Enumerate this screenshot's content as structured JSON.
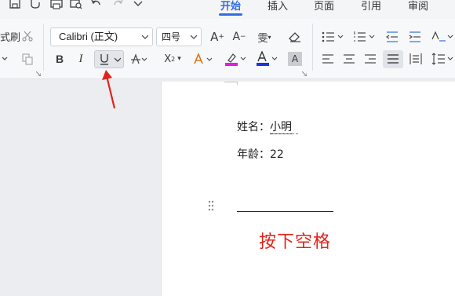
{
  "tabs": [
    {
      "label": "开始",
      "active": true
    },
    {
      "label": "插入",
      "active": false
    },
    {
      "label": "页面",
      "active": false
    },
    {
      "label": "引用",
      "active": false
    },
    {
      "label": "审阅",
      "active": false
    }
  ],
  "quick_access": [
    "save-icon",
    "format-painter-small-icon",
    "print-icon",
    "print-preview-icon",
    "undo-icon",
    "redo-icon",
    "more-chevron-icon"
  ],
  "clipboard": {
    "format_painter_label": "式刷"
  },
  "font": {
    "name": "Calibri (正文)",
    "size": "四号"
  },
  "format_buttons": [
    "bold-icon",
    "italic-icon",
    "underline-icon",
    "strikethrough-icon",
    "superscript-icon",
    "text-effect-icon",
    "highlight-icon",
    "font-color-icon",
    "char-shading-icon"
  ],
  "colors": {
    "accent": "#2f6fe4",
    "highlight": "#e01ee0",
    "font_color": "#1a35e0",
    "annotation": "#e2231a"
  },
  "document": {
    "name_label": "姓名：",
    "name_value": "小明",
    "age_label": "年龄：",
    "age_value": "22"
  },
  "annotation": "按下空格"
}
